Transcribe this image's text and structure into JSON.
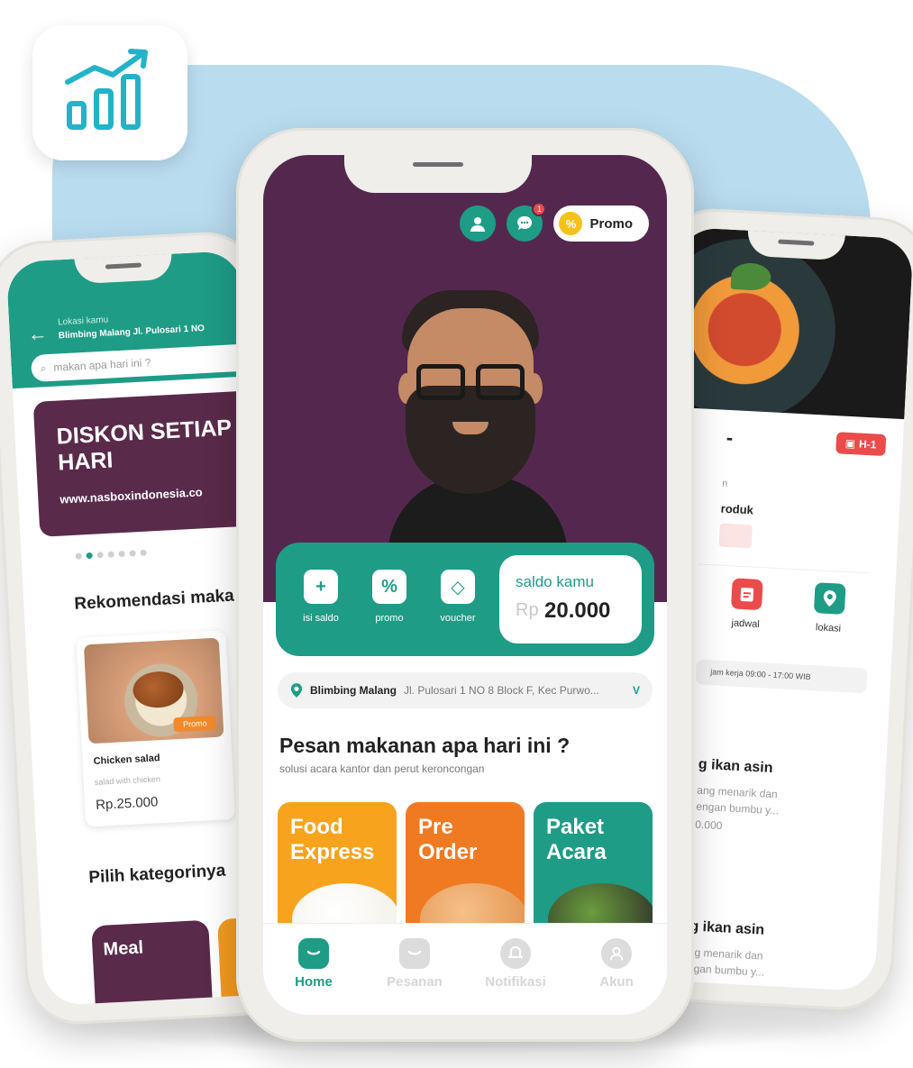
{
  "left_screen": {
    "location_label": "Lokasi kamu",
    "location_value": "Blimbing Malang Jl. Pulosari 1 NO",
    "search_placeholder": "makan apa hari ini ?",
    "banner_title": "DISKON SETIAP HARI",
    "banner_url": "www.nasboxindonesia.co",
    "recommend_heading": "Rekomendasi maka",
    "product": {
      "name": "Chicken salad",
      "description": "salad with chicken",
      "price": "Rp.25.000",
      "badge": "Promo"
    },
    "category_heading": "Pilih kategorinya",
    "category": "Meal"
  },
  "center_screen": {
    "notification_count": "1",
    "promo_label": "Promo",
    "promo_symbol": "%",
    "actions": [
      {
        "label": "isi saldo",
        "icon": "+"
      },
      {
        "label": "promo",
        "icon": "%"
      },
      {
        "label": "voucher",
        "icon": "◇"
      }
    ],
    "balance": {
      "label": "saldo kamu",
      "currency": "Rp",
      "amount": "20.000"
    },
    "location": {
      "city": "Blimbing Malang",
      "address": "Jl. Pulosari 1 NO 8 Block F, Kec Purwo...",
      "chevron": "V"
    },
    "heading": "Pesan makanan apa hari ini ?",
    "subheading": "solusi acara kantor dan perut keroncongan",
    "categories": [
      {
        "title": "Food Express",
        "color": "#f7a31d"
      },
      {
        "title": "Pre Order",
        "color": "#f07a22"
      },
      {
        "title": "Paket Acara",
        "color": "#1e9c86"
      }
    ],
    "nav": [
      {
        "label": "Home"
      },
      {
        "label": "Pesanan"
      },
      {
        "label": "Notifikasi"
      },
      {
        "label": "Akun"
      }
    ]
  },
  "right_screen": {
    "title_fragment": "-",
    "badge": "H-1",
    "small_text": "n",
    "produk_label": "roduk",
    "icons": [
      {
        "label": "jadwal"
      },
      {
        "label": "lokasi"
      }
    ],
    "hours": "jam kerja 09:00 - 17:00 WIB",
    "items": [
      {
        "title": "g ikan asin",
        "desc_1": "ang menarik dan",
        "desc_2": "engan bumbu y...",
        "price": "0.000"
      },
      {
        "title": "g ikan asin",
        "desc_1": "ng menarik dan",
        "desc_2": "ngan bumbu y..."
      }
    ]
  },
  "colors": {
    "brand_green": "#1e9c86",
    "brand_purple": "#54284e",
    "accent_orange": "#f7a31d",
    "alert_red": "#ea4b4b",
    "background_blue": "#b9dcef"
  }
}
